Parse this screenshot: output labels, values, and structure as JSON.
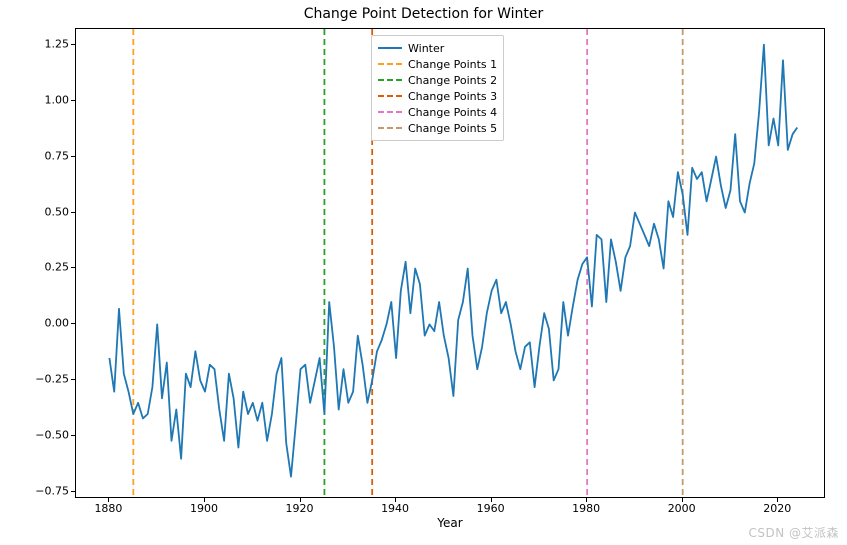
{
  "chart_data": {
    "type": "line",
    "title": "Change Point Detection for Winter",
    "xlabel": "Year",
    "ylabel": "",
    "xlim": [
      1873,
      2030
    ],
    "ylim": [
      -0.78,
      1.32
    ],
    "xticks": [
      1880,
      1900,
      1920,
      1940,
      1960,
      1980,
      2000,
      2020
    ],
    "yticks": [
      -0.75,
      -0.5,
      -0.25,
      0.0,
      0.25,
      0.5,
      0.75,
      1.0,
      1.25
    ],
    "xtick_labels": [
      "1880",
      "1900",
      "1920",
      "1940",
      "1960",
      "1980",
      "2000",
      "2020"
    ],
    "ytick_labels": [
      "−0.75",
      "−0.50",
      "−0.25",
      "0.00",
      "0.25",
      "0.50",
      "0.75",
      "1.00",
      "1.25"
    ],
    "series": [
      {
        "name": "Winter",
        "color": "#1f77b4",
        "style": "solid",
        "x": [
          1880,
          1881,
          1882,
          1883,
          1884,
          1885,
          1886,
          1887,
          1888,
          1889,
          1890,
          1891,
          1892,
          1893,
          1894,
          1895,
          1896,
          1897,
          1898,
          1899,
          1900,
          1901,
          1902,
          1903,
          1904,
          1905,
          1906,
          1907,
          1908,
          1909,
          1910,
          1911,
          1912,
          1913,
          1914,
          1915,
          1916,
          1917,
          1918,
          1919,
          1920,
          1921,
          1922,
          1923,
          1924,
          1925,
          1926,
          1927,
          1928,
          1929,
          1930,
          1931,
          1932,
          1933,
          1934,
          1935,
          1936,
          1937,
          1938,
          1939,
          1940,
          1941,
          1942,
          1943,
          1944,
          1945,
          1946,
          1947,
          1948,
          1949,
          1950,
          1951,
          1952,
          1953,
          1954,
          1955,
          1956,
          1957,
          1958,
          1959,
          1960,
          1961,
          1962,
          1963,
          1964,
          1965,
          1966,
          1967,
          1968,
          1969,
          1970,
          1971,
          1972,
          1973,
          1974,
          1975,
          1976,
          1977,
          1978,
          1979,
          1980,
          1981,
          1982,
          1983,
          1984,
          1985,
          1986,
          1987,
          1988,
          1989,
          1990,
          1991,
          1992,
          1993,
          1994,
          1995,
          1996,
          1997,
          1998,
          1999,
          2000,
          2001,
          2002,
          2003,
          2004,
          2005,
          2006,
          2007,
          2008,
          2009,
          2010,
          2011,
          2012,
          2013,
          2014,
          2015,
          2016,
          2017,
          2018,
          2019,
          2020,
          2021,
          2022,
          2023,
          2024
        ],
        "values": [
          -0.15,
          -0.3,
          0.07,
          -0.22,
          -0.3,
          -0.4,
          -0.35,
          -0.42,
          -0.4,
          -0.28,
          0.0,
          -0.33,
          -0.17,
          -0.52,
          -0.38,
          -0.6,
          -0.22,
          -0.28,
          -0.12,
          -0.25,
          -0.3,
          -0.18,
          -0.2,
          -0.38,
          -0.52,
          -0.22,
          -0.33,
          -0.55,
          -0.3,
          -0.4,
          -0.35,
          -0.43,
          -0.35,
          -0.52,
          -0.4,
          -0.22,
          -0.15,
          -0.53,
          -0.68,
          -0.45,
          -0.2,
          -0.18,
          -0.35,
          -0.25,
          -0.15,
          -0.4,
          0.1,
          -0.1,
          -0.38,
          -0.2,
          -0.35,
          -0.3,
          -0.05,
          -0.18,
          -0.35,
          -0.25,
          -0.12,
          -0.07,
          0.0,
          0.1,
          -0.15,
          0.15,
          0.28,
          0.05,
          0.25,
          0.18,
          -0.05,
          0.0,
          -0.03,
          0.1,
          -0.05,
          -0.15,
          -0.32,
          0.02,
          0.1,
          0.25,
          -0.05,
          -0.2,
          -0.1,
          0.05,
          0.15,
          0.2,
          0.05,
          0.1,
          0.0,
          -0.12,
          -0.2,
          -0.1,
          -0.08,
          -0.28,
          -0.1,
          0.05,
          -0.02,
          -0.25,
          -0.2,
          0.1,
          -0.05,
          0.08,
          0.2,
          0.27,
          0.3,
          0.08,
          0.4,
          0.38,
          0.1,
          0.38,
          0.28,
          0.15,
          0.3,
          0.35,
          0.5,
          0.45,
          0.4,
          0.35,
          0.45,
          0.38,
          0.25,
          0.55,
          0.48,
          0.68,
          0.58,
          0.4,
          0.7,
          0.65,
          0.68,
          0.55,
          0.65,
          0.75,
          0.62,
          0.52,
          0.6,
          0.85,
          0.55,
          0.5,
          0.63,
          0.72,
          0.95,
          1.25,
          0.8,
          0.92,
          0.8,
          1.18,
          0.78,
          0.85,
          0.88
        ]
      }
    ],
    "change_points": [
      {
        "name": "Change Points 1",
        "x": 1885,
        "color": "#ff9f1c",
        "style": "dashed"
      },
      {
        "name": "Change Points 2",
        "x": 1925,
        "color": "#2ca02c",
        "style": "dashed"
      },
      {
        "name": "Change Points 3",
        "x": 1935,
        "color": "#d95f02",
        "style": "dashed"
      },
      {
        "name": "Change Points 4",
        "x": 1980,
        "color": "#e377c2",
        "style": "dashed"
      },
      {
        "name": "Change Points 5",
        "x": 2000,
        "color": "#c49a6c",
        "style": "dashed"
      }
    ],
    "legend": {
      "position": "upper-center",
      "entries": [
        "Winter",
        "Change Points 1",
        "Change Points 2",
        "Change Points 3",
        "Change Points 4",
        "Change Points 5"
      ]
    }
  },
  "watermark": "CSDN @艾派森"
}
